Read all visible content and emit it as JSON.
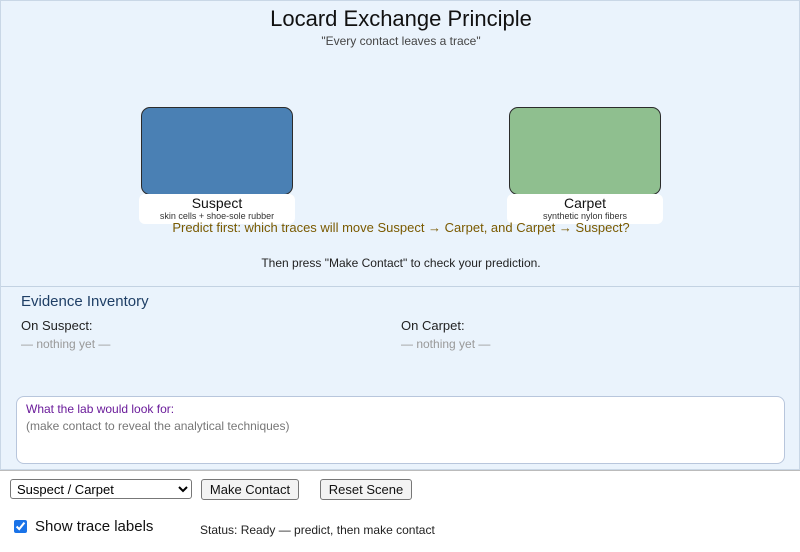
{
  "header": {
    "title": "Locard Exchange Principle",
    "subtitle": "\"Every contact leaves a trace\""
  },
  "scene": {
    "objects": [
      {
        "name": "Suspect",
        "description": "skin cells + shoe-sole rubber",
        "color": "#4a80b4"
      },
      {
        "name": "Carpet",
        "description": "synthetic nylon fibers",
        "color": "#8fbf8f"
      }
    ],
    "prompt": "Predict first: which traces will move Suspect → Carpet, and Carpet → Suspect?",
    "instruction": "Then press \"Make Contact\" to check your prediction."
  },
  "inventory": {
    "title": "Evidence Inventory",
    "on_suspect_label": "On Suspect:",
    "on_suspect_empty": "— nothing yet —",
    "on_carpet_label": "On Carpet:",
    "on_carpet_empty": "— nothing yet —"
  },
  "lab": {
    "heading": "What the lab would look for:",
    "hint": "(make contact to reveal the analytical techniques)"
  },
  "controls": {
    "pair_select_value": "Suspect / Carpet",
    "make_contact_label": "Make Contact",
    "reset_label": "Reset Scene",
    "show_labels_label": "Show trace labels",
    "show_labels_checked": true,
    "status": "Status: Ready — predict, then make contact"
  },
  "colors": {
    "panel_background": "#eaf3fc",
    "prompt_text": "#7a5a00",
    "inventory_title": "#1f3f66",
    "lab_heading": "#6a1b9a"
  }
}
